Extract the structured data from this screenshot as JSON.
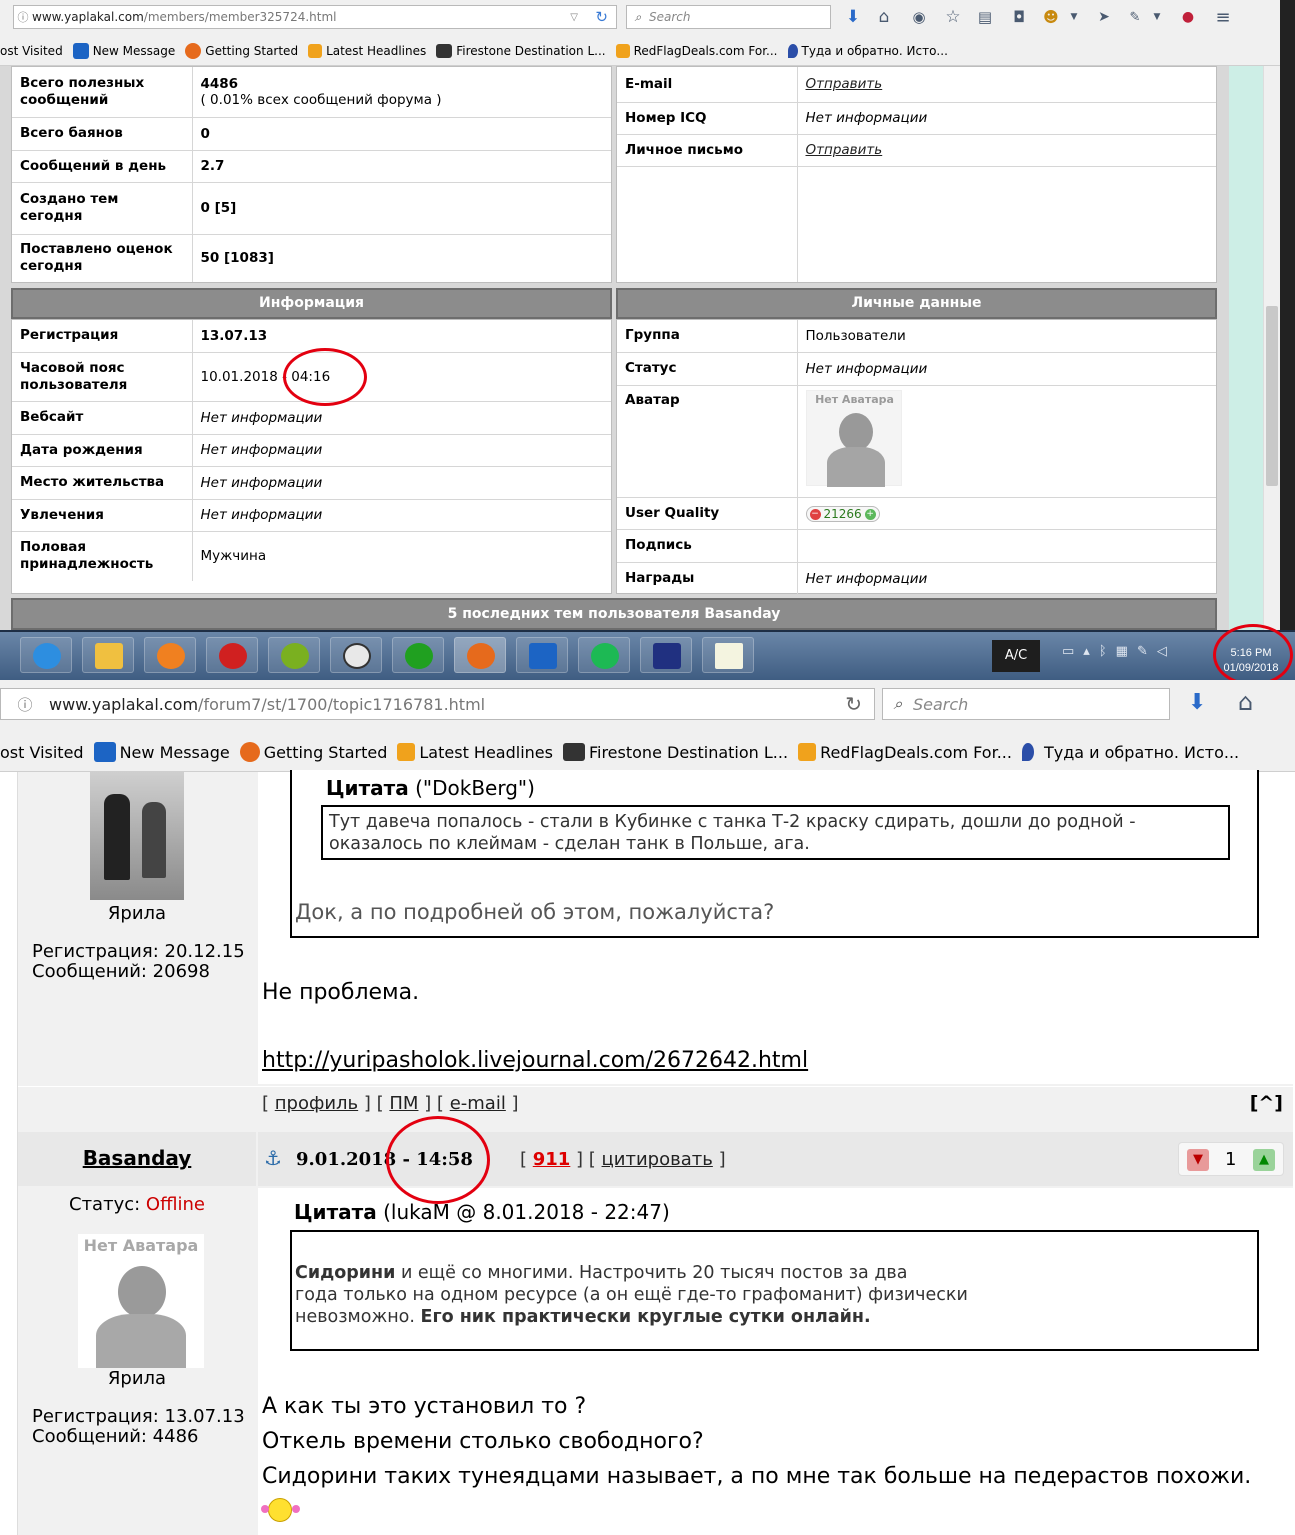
{
  "browser_top": {
    "url_host": "www.yaplakal.com",
    "url_path": "/members/member325724.html",
    "search_placeholder": "Search",
    "bookmarks": [
      "ost Visited",
      "New Message",
      "Getting Started",
      "Latest Headlines",
      "Firestone Destination L...",
      "RedFlagDeals.com For...",
      "Туда и обратно. Исто..."
    ]
  },
  "stats_left": [
    {
      "k": "Всего полезных сообщений",
      "v": "4486",
      "v2": "( 0.01% всех сообщений форума )"
    },
    {
      "k": "Всего баянов",
      "v": "0"
    },
    {
      "k": "Сообщений в день",
      "v": "2.7"
    },
    {
      "k": "Создано тем сегодня",
      "v": "0 [5]"
    },
    {
      "k": "Поставлено оценок сегодня",
      "v": "50 [1083]"
    }
  ],
  "stats_right": [
    {
      "k": "E-mail",
      "v": "Отправить"
    },
    {
      "k": "Номер ICQ",
      "v": "Нет информации"
    },
    {
      "k": "Личное письмо",
      "v": "Отправить"
    }
  ],
  "info_header": "Информация",
  "personal_header": "Личные данные",
  "info": [
    {
      "k": "Регистрация",
      "v": "13.07.13"
    },
    {
      "k": "Часовой пояс пользователя",
      "v": "10.01.2018 - 04:16"
    },
    {
      "k": "Вебсайт",
      "v": "Нет информации"
    },
    {
      "k": "Дата рождения",
      "v": "Нет информации"
    },
    {
      "k": "Место жительства",
      "v": "Нет информации"
    },
    {
      "k": "Увлечения",
      "v": "Нет информации"
    },
    {
      "k": "Половая принадлежность",
      "v": "Мужчина"
    }
  ],
  "personal": [
    {
      "k": "Группа",
      "v": "Пользователи"
    },
    {
      "k": "Статус",
      "v": "Нет информации"
    },
    {
      "k": "Аватар",
      "v": "Нет Аватара"
    },
    {
      "k": "User Quality",
      "v": "21266"
    },
    {
      "k": "Подпись",
      "v": ""
    },
    {
      "k": "Награды",
      "v": "Нет информации"
    }
  ],
  "last_topics_header": "5 последних тем пользователя Basanday",
  "taskbar": {
    "lang": "A/C",
    "time": "5:16 PM",
    "date": "01/09/2018"
  },
  "browser_bottom": {
    "url_host": "www.yaplakal.com",
    "url_path": "/forum7/st/1700/topic1716781.html",
    "search_placeholder": "Search",
    "bookmarks": [
      "ost Visited",
      "New Message",
      "Getting Started",
      "Latest Headlines",
      "Firestone Destination L...",
      "RedFlagDeals.com For...",
      "Туда и обратно. Исто..."
    ]
  },
  "post1": {
    "rank": "Ярила",
    "reg": "Регистрация: 20.12.15",
    "msgs": "Сообщений: 20698",
    "quote_label": "Цитата",
    "quote_author": "(\"DokBerg\")",
    "quote_text": "Тут давеча попалось - стали в Кубинке с танка Т-2 краску сдирать, дошли до родной - оказалось по клеймам - сделан танк в Польше, ага.",
    "reply": "Док, а по подробней об этом, пожалуйста?",
    "body1": "Не проблема.",
    "link": "http://yuripasholok.livejournal.com/2672642.html",
    "links": [
      "профиль",
      "ПМ",
      "e-mail"
    ],
    "top": "[^]"
  },
  "post2": {
    "author": "Basanday",
    "status_label": "Статус:",
    "status": "Offline",
    "avatar_text": "Нет Аватара",
    "rank": "Ярила",
    "reg": "Регистрация: 13.07.13",
    "msgs": "Сообщений: 4486",
    "date": "9.01.2018 - 14:58",
    "num": "911",
    "cite": "цитировать",
    "rating": "1",
    "quote_label": "Цитата",
    "quote_author": "(lukaM @ 8.01.2018 - 22:47)",
    "q_bold1": "Сидорини",
    "q_text1": " и ещё со многими. Настрочить 20 тысяч постов за два",
    "q_text2": "года только на одном ресурсе (а он ещё где-то графоманит) физически",
    "q_text3": "невозможно. ",
    "q_bold2": "Его ник практически круглые сутки онлайн.",
    "body1": "А как ты это установил то ?",
    "body2": "Откель времени столько свободного?",
    "body3": "Сидорини таких тунеядцами называет, а по мне так больше на педерастов похожи."
  }
}
